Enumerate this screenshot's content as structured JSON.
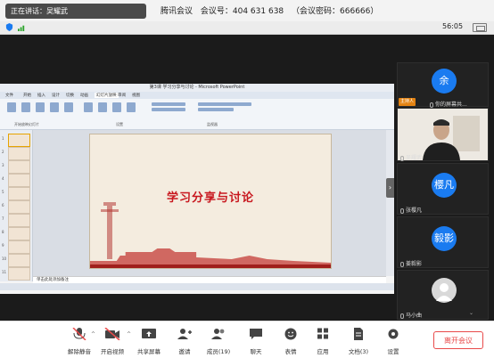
{
  "top_bar": {
    "speaking_label": "正在讲话：吴耀武",
    "app_name": "腾讯会议",
    "meeting_number_label": "会议号：404 631 638",
    "password_label": "（会议密码：666666）"
  },
  "status_row": {
    "time": "56:05",
    "icons": [
      "shield-icon",
      "signal-icon"
    ]
  },
  "shared_screen": {
    "window_title": "第3课 学习分享与讨论 - Microsoft PowerPoint",
    "tabs": [
      "文件",
      "开始",
      "插入",
      "设计",
      "切换",
      "动画",
      "幻灯片放映",
      "审阅",
      "视图"
    ],
    "active_tab": "幻灯片放映",
    "ribbon_groups": [
      "开始放映幻灯片",
      "设置",
      "监视器"
    ],
    "slide_title": "学习分享与讨论",
    "notes_placeholder": "单击此处添加备注",
    "thumbnail_count": 11,
    "accent_red": "#c8171e"
  },
  "participants": [
    {
      "name": "余",
      "display": "你的屏幕共...",
      "role": "主持人",
      "avatar_text": "余",
      "avatar_color": "#1a7bf0",
      "has_video": false
    },
    {
      "name": "吴耀武",
      "display": "吴耀武",
      "has_video": true
    },
    {
      "name": "张樱凡",
      "display": "张樱凡",
      "avatar_text": "樱凡",
      "avatar_color": "#1a7bf0",
      "has_video": false
    },
    {
      "name": "姜毅影",
      "display": "姜毅影",
      "avatar_text": "毅影",
      "avatar_color": "#1a7bf0",
      "has_video": false
    },
    {
      "name": "马小曲",
      "display": "马小曲",
      "has_video": false
    }
  ],
  "toolbar": {
    "items": [
      {
        "label": "解除静音",
        "icon": "mic-muted-icon"
      },
      {
        "label": "开启视频",
        "icon": "camera-off-icon"
      },
      {
        "label": "共享屏幕",
        "icon": "share-screen-icon"
      },
      {
        "label": "邀请",
        "icon": "invite-icon"
      },
      {
        "label": "成员(19)",
        "icon": "members-icon"
      },
      {
        "label": "聊天",
        "icon": "chat-icon"
      },
      {
        "label": "表情",
        "icon": "emoji-icon"
      },
      {
        "label": "应用",
        "icon": "apps-icon"
      },
      {
        "label": "文档(3)",
        "icon": "document-icon"
      },
      {
        "label": "设置",
        "icon": "settings-icon"
      }
    ],
    "leave_label": "离开会议",
    "leave_color": "#e84a4a"
  }
}
